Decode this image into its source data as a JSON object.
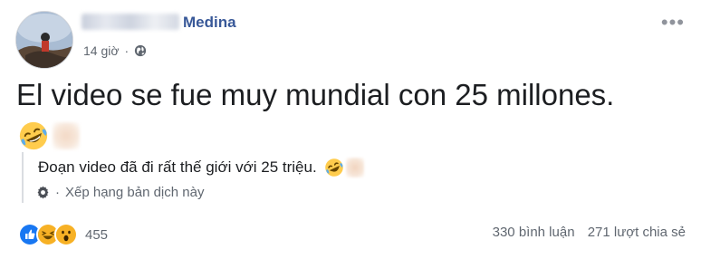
{
  "post": {
    "author_name": "Medina",
    "timestamp": "14 giờ",
    "separator": "·",
    "privacy_icon": "globe-icon",
    "more_icon": "more-icon",
    "text": "El video se fue muy mundial con 25 millones.",
    "emoji": "rolling-on-floor-laughing-icon",
    "translation": {
      "text": "Đoạn video đã đi rất thế giới với 25 triệu.",
      "rate_label": "Xếp hạng bản dịch này",
      "rate_icon": "gear-icon"
    },
    "reactions": {
      "types": [
        "like-icon",
        "haha-icon",
        "wow-icon"
      ],
      "count": "455"
    },
    "comments": "330 bình luận",
    "shares": "271 lượt chia sẻ"
  },
  "colors": {
    "link_blue": "#385898",
    "meta_gray": "#606770",
    "text_dark": "#1c1e21",
    "like_blue": "#1877f2",
    "reaction_yellow": "#f7b125"
  }
}
